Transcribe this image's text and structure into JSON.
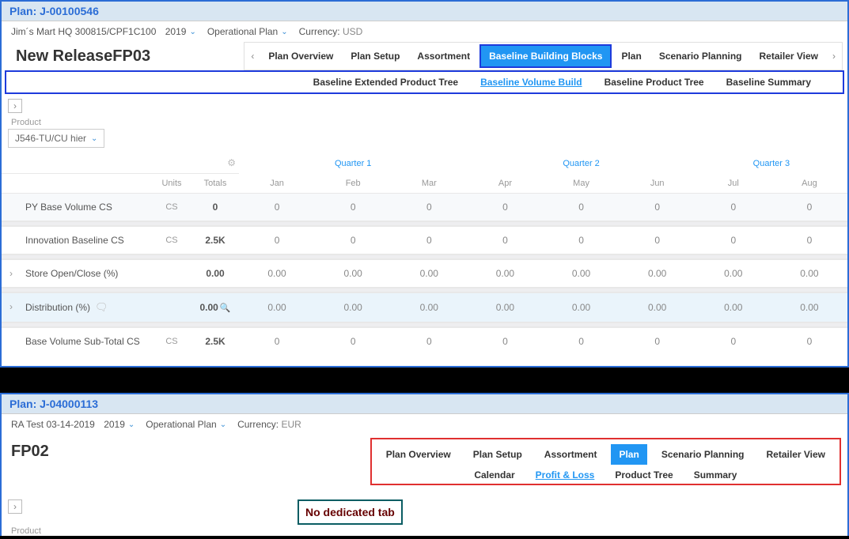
{
  "panel1": {
    "title": "Plan: J-00100546",
    "account": "Jim´s Mart HQ 300815/CPF1C100",
    "year": "2019",
    "planType": "Operational Plan",
    "currencyLabel": "Currency:",
    "currencyVal": "USD",
    "brand": "New ReleaseFP03",
    "tabs": [
      "Plan Overview",
      "Plan Setup",
      "Assortment",
      "Baseline Building Blocks",
      "Plan",
      "Scenario Planning",
      "Retailer View"
    ],
    "tabsActive": "Baseline Building Blocks",
    "subtabs": [
      "Baseline Extended Product Tree",
      "Baseline Volume Build",
      "Baseline Product Tree",
      "Baseline Summary"
    ],
    "subtabActive": "Baseline Volume Build",
    "productLabel": "Product",
    "productVal": "J546-TU/CU hier",
    "unitsHdr": "Units",
    "totalsHdr": "Totals",
    "quarters": [
      "Quarter 1",
      "Quarter 2",
      "Quarter 3"
    ],
    "months": [
      "Jan",
      "Feb",
      "Mar",
      "Apr",
      "May",
      "Jun",
      "Jul",
      "Aug"
    ],
    "rows": [
      {
        "label": "PY Base Volume  CS",
        "units": "CS",
        "total": "0",
        "vals": [
          "0",
          "0",
          "0",
          "0",
          "0",
          "0",
          "0",
          "0"
        ],
        "striped": true
      },
      {
        "label": "Innovation Baseline    CS",
        "units": "CS",
        "total": "2.5K",
        "vals": [
          "0",
          "0",
          "0",
          "0",
          "0",
          "0",
          "0",
          "0"
        ]
      },
      {
        "label": "Store Open/Close (%)",
        "units": "",
        "total": "0.00",
        "vals": [
          "0.00",
          "0.00",
          "0.00",
          "0.00",
          "0.00",
          "0.00",
          "0.00",
          "0.00"
        ],
        "expand": true
      },
      {
        "label": "Distribution (%)",
        "units": "",
        "total": "0.00",
        "vals": [
          "0.00",
          "0.00",
          "0.00",
          "0.00",
          "0.00",
          "0.00",
          "0.00",
          "0.00"
        ],
        "expand": true,
        "comment": true,
        "highlight": true,
        "mag": true
      },
      {
        "label": "Base Volume Sub-Total  CS",
        "units": "CS",
        "total": "2.5K",
        "vals": [
          "0",
          "0",
          "0",
          "0",
          "0",
          "0",
          "0",
          "0"
        ]
      }
    ]
  },
  "panel2": {
    "title": "Plan: J-04000113",
    "account": "RA Test 03-14-2019",
    "year": "2019",
    "planType": "Operational Plan",
    "currencyLabel": "Currency:",
    "currencyVal": "EUR",
    "brand": "FP02",
    "tabs": [
      "Plan Overview",
      "Plan Setup",
      "Assortment",
      "Plan",
      "Scenario Planning",
      "Retailer View"
    ],
    "tabsActive": "Plan",
    "subtabs": [
      "Calendar",
      "Profit & Loss",
      "Product Tree",
      "Summary"
    ],
    "subtabActive": "Profit & Loss",
    "noDedicated": "No dedicated tab",
    "productLabel": "Product"
  },
  "chevrons": {
    "left": "‹",
    "right": "›",
    "down": "⌄"
  }
}
